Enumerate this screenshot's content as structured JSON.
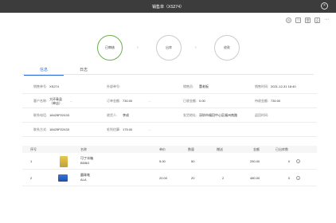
{
  "window": {
    "title": "销售单（XS274）",
    "close": "×"
  },
  "toolbar": {
    "icons": [
      "gear-icon",
      "copy-icon",
      "delete-icon",
      "print-icon"
    ],
    "more": "···"
  },
  "steps": [
    "已审核",
    "出库",
    "收款"
  ],
  "tabs": [
    "信息",
    "日志"
  ],
  "form": {
    "row1": [
      {
        "label": "销售单号:",
        "value": "XS274"
      },
      {
        "label": "外部单号:",
        "value": ""
      },
      {
        "label": "销售员:",
        "value": "董老板"
      },
      {
        "label": "销售时间:",
        "value": "2021-12-31 18:40"
      }
    ],
    "row2": [
      {
        "label": "客户名称:",
        "value": "大环青县（单店）"
      },
      {
        "label": "订单金额:",
        "value": "730.00"
      },
      {
        "label": "已收金额:",
        "value": "0.00"
      },
      {
        "label": "待收金额:",
        "value": "730.00"
      }
    ],
    "row3": [
      {
        "label": "联系电话:",
        "value": "18425P22433"
      },
      {
        "label": "收货人:",
        "value": "李成"
      },
      {
        "label": "发货地址:",
        "value": "深圳市福田中心区福州南路"
      },
      {
        "label": "返回时间:",
        "value": ""
      }
    ],
    "row4": [
      {
        "label": "联系方式:",
        "value": "18425P22433"
      },
      {
        "label": "毛利估算:",
        "value": "175.00"
      }
    ]
  },
  "table": {
    "headers": [
      "序号",
      "名称",
      "单价",
      "数量",
      "赠送",
      "金额",
      "已出库数"
    ],
    "rows": [
      {
        "no": "1",
        "name": "可丁冰箱",
        "sub": "BDBG",
        "price": "5.00",
        "qty": "50",
        "gift": "",
        "amount": "250.00",
        "out": "0"
      },
      {
        "no": "2",
        "name": "圆珠笔",
        "sub": "ALA",
        "price": "20.00",
        "qty": "20",
        "gift": "2",
        "amount": "480.00",
        "out": "0"
      }
    ]
  }
}
